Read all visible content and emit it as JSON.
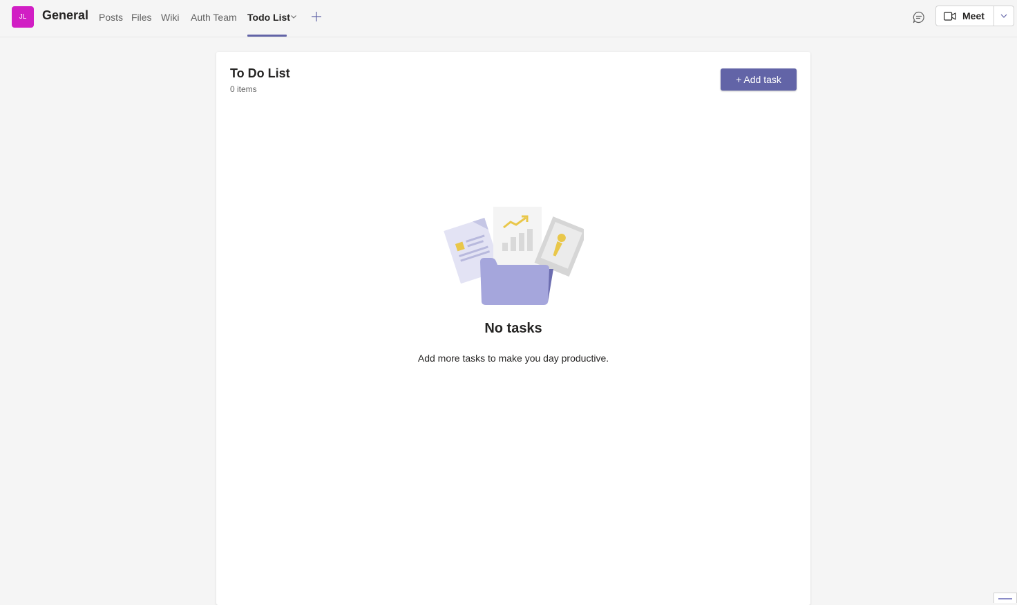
{
  "header": {
    "avatar_initials": "JL",
    "channel_title": "General",
    "tabs": [
      {
        "label": "Posts",
        "active": false
      },
      {
        "label": "Files",
        "active": false
      },
      {
        "label": "Wiki",
        "active": false
      },
      {
        "label": "Auth Team",
        "active": false
      },
      {
        "label": "Todo List",
        "active": true
      }
    ],
    "meet_label": "Meet"
  },
  "todo": {
    "title": "To Do List",
    "count_text": "0 items",
    "add_task_label": "+ Add task",
    "empty_title": "No tasks",
    "empty_description": "Add more tasks to make you day productive."
  },
  "colors": {
    "brand": "#6264a7",
    "avatar": "#d11ec4",
    "background": "#f5f5f5"
  }
}
